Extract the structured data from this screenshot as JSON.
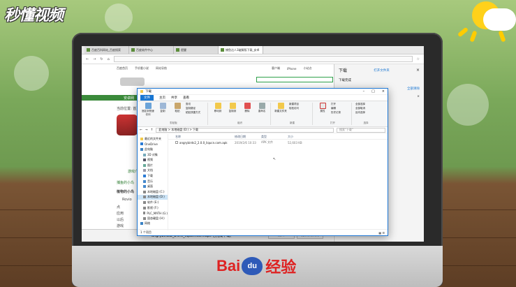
{
  "watermark": {
    "brand_text": "秒懂视频"
  },
  "footer_brand": {
    "bai": "Bai",
    "du": "du",
    "jingyan": "经验"
  },
  "browser": {
    "tabs": [
      "百度百科网站_百度搜索",
      "百度软件中心",
      "提醒",
      "捕鱼达人3破解版下载_安卓"
    ],
    "url": "",
    "menu": [
      "百度首页",
      "手机看小说",
      "网站导航",
      "客户端",
      "iPhone",
      "小站点"
    ],
    "page_texts": [
      "安卓网",
      "当前位置: 首页",
      "游戏介绍",
      "捕鱼的小鸟",
      "植物的小鸟",
      "Rovio",
      "点",
      "应用",
      "以后",
      "游戏",
      "全部",
      "《植物",
      "地名"
    ],
    "save_bar": {
      "text": "angrybirds2_2.0.0_liqucn.com.apk 已完成下载。",
      "open_btn": "打开",
      "open_folder_btn": "打开文件夹"
    }
  },
  "download_panel": {
    "title": "下载",
    "open_folder": "打开文件夹",
    "section": "下载完成",
    "clear_all": "全部清除",
    "close": "×"
  },
  "explorer": {
    "title": "下载",
    "ribbon_tabs": [
      "文件",
      "主页",
      "共享",
      "查看"
    ],
    "ribbon_groups": [
      {
        "name": "剪贴板",
        "items": [
          "固定到快速访问",
          "复制",
          "粘贴",
          "剪切",
          "复制路径",
          "粘贴快捷方式"
        ]
      },
      {
        "name": "组织",
        "items": [
          "移动到",
          "复制到",
          "删除",
          "重命名"
        ]
      },
      {
        "name": "新建",
        "items": [
          "新建文件夹",
          "新建项目",
          "轻松访问"
        ]
      },
      {
        "name": "打开",
        "items": [
          "属性",
          "打开",
          "编辑",
          "历史记录"
        ]
      },
      {
        "name": "选择",
        "items": [
          "全部选择",
          "全部取消",
          "反向选择"
        ]
      }
    ],
    "path": "此电脑 > 本地磁盘 (D:) > 下载",
    "search_placeholder": "搜索\"下载\"",
    "tree": [
      "最近的文件夹",
      "OneDrive",
      "此电脑",
      "3D 对象",
      "视频",
      "图片",
      "文档",
      "下载",
      "音乐",
      "桌面",
      "本地磁盘 (C:)",
      "本地磁盘 (D:)",
      "软件 (E:)",
      "影视 (F:)",
      "PLC_MATH (G:)",
      "固态硬盘 (H:)",
      "网络"
    ],
    "selected_tree_index": 11,
    "columns": [
      "名称",
      "修改日期",
      "类型",
      "大小"
    ],
    "files": [
      {
        "name": "angrybirds2_2.0.0_liqucn.com.apk",
        "date": "2019/2/6 10:33",
        "type": "APK 文件",
        "size": "52,603 KB"
      }
    ],
    "status": "1 个项目"
  },
  "colors": {
    "accent": "#1976d2",
    "sun": "#ffd11a",
    "brand_red": "#de2222",
    "brand_blue": "#2e5ab8"
  }
}
